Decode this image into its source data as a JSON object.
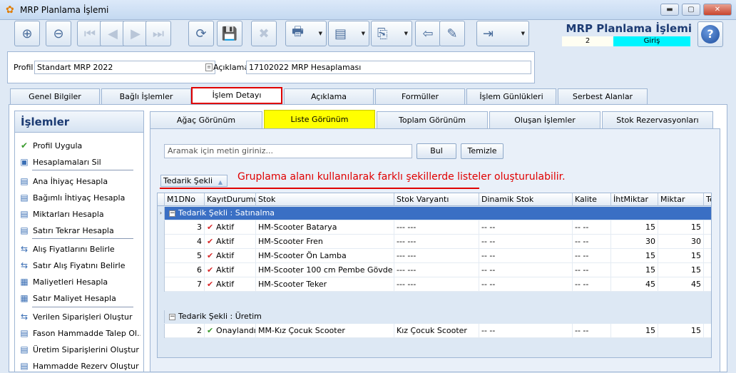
{
  "window": {
    "title": "MRP Planlama İşlemi",
    "minimize": "▬",
    "maximize": "▢",
    "close": "✕"
  },
  "header": {
    "title": "MRP Planlama İşlemi",
    "number": "2",
    "state": "Giriş",
    "help": "?"
  },
  "toolbar": {
    "buttons": [
      {
        "name": "new-record-button",
        "icon": "⊕"
      },
      {
        "name": "delete-record-button",
        "icon": "⊖"
      },
      {
        "name": "first-record-button",
        "icon": "⏮"
      },
      {
        "name": "previous-record-button",
        "icon": "◀"
      },
      {
        "name": "next-record-button",
        "icon": "▶"
      },
      {
        "name": "last-record-button",
        "icon": "⏭"
      },
      {
        "name": "refresh-button",
        "icon": "⟳"
      },
      {
        "name": "save-button",
        "icon": "💾"
      },
      {
        "name": "cancel-save-button",
        "icon": "✖"
      },
      {
        "name": "print-button",
        "icon": "🖶"
      },
      {
        "name": "pdf-export-button",
        "icon": "▤"
      },
      {
        "name": "copy-button",
        "icon": "⎘"
      },
      {
        "name": "import-button",
        "icon": "⇦"
      },
      {
        "name": "tools-button",
        "icon": "✎"
      },
      {
        "name": "exit-button",
        "icon": "⇥"
      }
    ]
  },
  "profile": {
    "label": "Profil",
    "value": "Standart MRP 2022",
    "desc_label": "Açıklama",
    "desc_value": "17102022 MRP Hesaplaması"
  },
  "tabs": [
    "Genel Bilgiler",
    "Bağlı İşlemler",
    "İşlem Detayı",
    "Açıklama",
    "Formüller",
    "İşlem Günlükleri",
    "Serbest Alanlar"
  ],
  "left_panel": {
    "title": "İşlemler",
    "items": [
      {
        "label": "Profil Uygula",
        "icon": "✔"
      },
      {
        "label": "Hesaplamaları Sil",
        "icon": "▣"
      },
      {
        "label": "Ana İhiyaç Hesapla",
        "icon": "▤"
      },
      {
        "label": "Bağımlı İhtiyaç Hesapla",
        "icon": "▤"
      },
      {
        "label": "Miktarları Hesapla",
        "icon": "▤"
      },
      {
        "label": "Satırı Tekrar Hesapla",
        "icon": "▤"
      },
      {
        "label": "Alış Fiyatlarını Belirle",
        "icon": "⇆"
      },
      {
        "label": "Satır Alış Fiyatını Belirle",
        "icon": "⇆"
      },
      {
        "label": "Maliyetleri Hesapla",
        "icon": "▦"
      },
      {
        "label": "Satır Maliyet Hesapla",
        "icon": "▦"
      },
      {
        "label": "Verilen Siparişleri Oluştur",
        "icon": "⇆"
      },
      {
        "label": "Fason Hammadde Talep Ol...",
        "icon": "▤"
      },
      {
        "label": "Üretim Siparişlerini Oluştur",
        "icon": "▤"
      },
      {
        "label": "Hammadde Rezerv Oluştur",
        "icon": "▤"
      }
    ]
  },
  "subtabs": [
    "Ağaç Görünüm",
    "Liste Görünüm",
    "Toplam Görünüm",
    "Oluşan İşlemler",
    "Stok Rezervasyonları"
  ],
  "search": {
    "placeholder": "Aramak için metin giriniz...",
    "find": "Bul",
    "clear": "Temizle"
  },
  "grouping": {
    "field": "Tedarik Şekli",
    "annotation": "Gruplama alanı kullanılarak farklı şekillerde listeler oluşturulabilir."
  },
  "grid": {
    "columns": [
      "M1DNo",
      "KayıtDurumu",
      "Stok",
      "Stok Varyantı",
      "Dinamik Stok",
      "Kalite",
      "İhtMiktar",
      "Miktar",
      "Te"
    ],
    "groups": [
      {
        "title": "Tedarik Şekli : Satınalma",
        "rows": [
          {
            "no": "3",
            "status": "Aktif",
            "stock": "HM-Scooter Batarya",
            "variant": "--- ---",
            "dynamic": "-- --",
            "quality": "-- --",
            "req": "15",
            "qty": "15"
          },
          {
            "no": "4",
            "status": "Aktif",
            "stock": "HM-Scooter Fren",
            "variant": "--- ---",
            "dynamic": "-- --",
            "quality": "-- --",
            "req": "30",
            "qty": "30"
          },
          {
            "no": "5",
            "status": "Aktif",
            "stock": "HM-Scooter Ön Lamba",
            "variant": "--- ---",
            "dynamic": "-- --",
            "quality": "-- --",
            "req": "15",
            "qty": "15"
          },
          {
            "no": "6",
            "status": "Aktif",
            "stock": "HM-Scooter 100 cm Pembe Gövde",
            "variant": "--- ---",
            "dynamic": "-- --",
            "quality": "-- --",
            "req": "15",
            "qty": "15"
          },
          {
            "no": "7",
            "status": "Aktif",
            "stock": "HM-Scooter Teker",
            "variant": "--- ---",
            "dynamic": "-- --",
            "quality": "-- --",
            "req": "45",
            "qty": "45"
          }
        ]
      },
      {
        "title": "Tedarik Şekli : Üretim",
        "rows": [
          {
            "no": "2",
            "status": "Onaylandı",
            "stock": "MM-Kız Çocuk Scooter",
            "variant": "Kız Çocuk Scooter",
            "dynamic": "-- --",
            "quality": "-- --",
            "req": "15",
            "qty": "15"
          }
        ]
      }
    ]
  }
}
